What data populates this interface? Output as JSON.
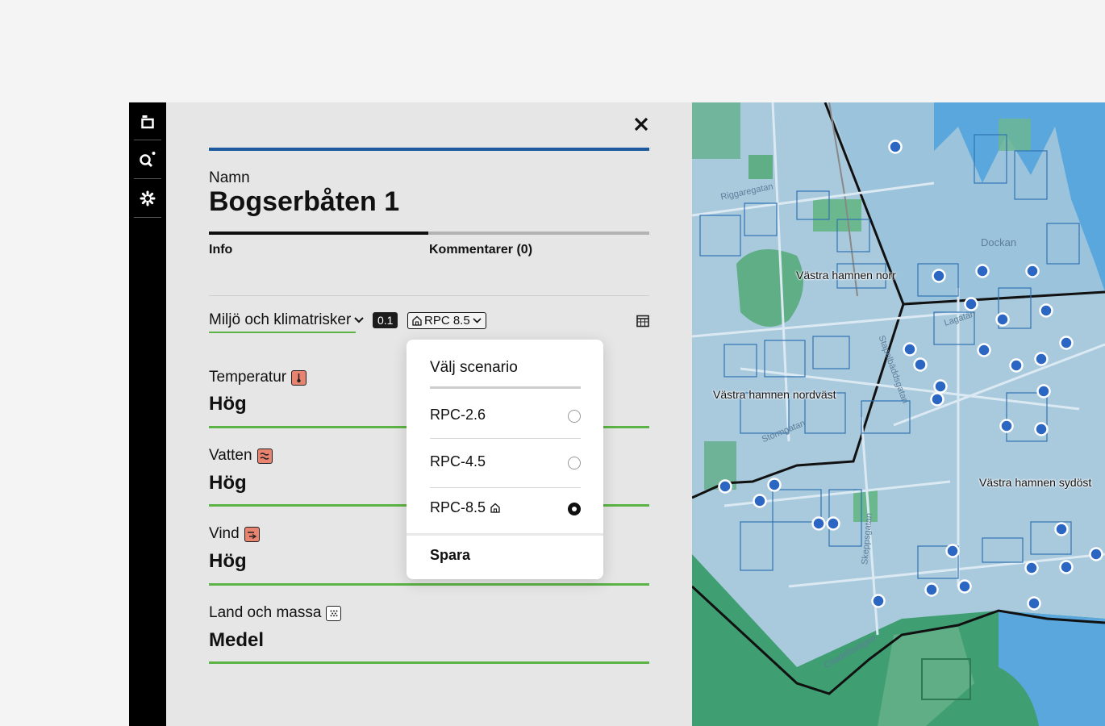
{
  "toolbar": {
    "items": [
      "layers-icon",
      "search-icon",
      "settings-icon"
    ]
  },
  "panel": {
    "name_label": "Namn",
    "title": "Bogserbåten 1",
    "tabs": [
      "Info",
      "Kommentarer (0)"
    ],
    "active_tab": "Info",
    "category": "Miljö och klimatrisker",
    "value": "0.1",
    "scenario": "RPC 8.5",
    "risks": [
      {
        "label": "Temperatur",
        "icon": "thermometer-icon",
        "value": "Hög"
      },
      {
        "label": "Vatten",
        "icon": "water-icon",
        "value": "Hög"
      },
      {
        "label": "Vind",
        "icon": "wind-icon",
        "value": "Hög"
      },
      {
        "label": "Land och massa",
        "icon": "ground-icon",
        "value": "Medel"
      }
    ]
  },
  "popup": {
    "title": "Välj scenario",
    "options": [
      {
        "label": "RPC-2.6",
        "selected": false
      },
      {
        "label": "RPC-4.5",
        "selected": false
      },
      {
        "label": "RPC-8.5",
        "selected": true,
        "icon": "home-icon"
      }
    ],
    "save": "Spara"
  },
  "map": {
    "areas": [
      "Västra hamnen norr",
      "Västra hamnen nordväst",
      "Västra hamnen sydöst"
    ],
    "streets": [
      "Riggaregatan",
      "Dockan",
      "Lagatan",
      "Stapelbäddsgatan",
      "Stormgatan",
      "Skeppsgatan",
      "Citadellsvägen"
    ],
    "colors": {
      "water": "#5aa7dd",
      "land": "#a9c9dd",
      "green": "#5fae86",
      "marker": "#2a66c2"
    }
  }
}
